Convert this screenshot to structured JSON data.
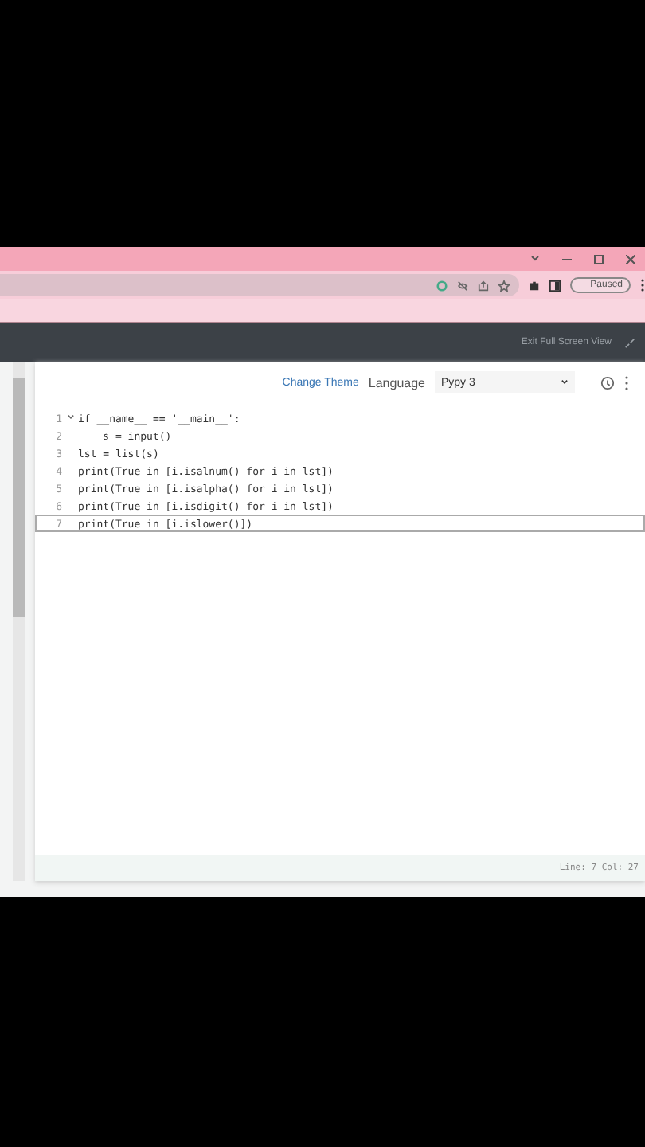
{
  "browser": {
    "profile_label": "Paused"
  },
  "top_bar": {
    "exit_label": "Exit Full Screen View"
  },
  "editor_toolbar": {
    "change_theme": "Change Theme",
    "language_label": "Language",
    "language_value": "Pypy 3"
  },
  "code_lines": [
    {
      "number": "1",
      "text": "if __name__ == '__main__':",
      "fold": true,
      "active": false
    },
    {
      "number": "2",
      "text": "    s = input()",
      "fold": false,
      "active": false
    },
    {
      "number": "3",
      "text": "lst = list(s)",
      "fold": false,
      "active": false
    },
    {
      "number": "4",
      "text": "print(True in [i.isalnum() for i in lst])",
      "fold": false,
      "active": false
    },
    {
      "number": "5",
      "text": "print(True in [i.isalpha() for i in lst])",
      "fold": false,
      "active": false
    },
    {
      "number": "6",
      "text": "print(True in [i.isdigit() for i in lst])",
      "fold": false,
      "active": false
    },
    {
      "number": "7",
      "text": "print(True in [i.islower()])",
      "fold": false,
      "active": true
    }
  ],
  "status": "Line: 7 Col: 27"
}
